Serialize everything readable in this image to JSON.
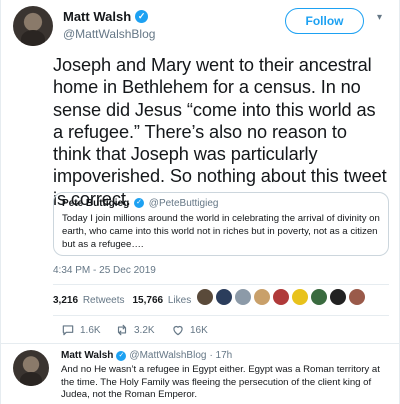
{
  "tweet": {
    "author_name": "Matt Walsh",
    "author_handle": "@MattWalshBlog",
    "follow_label": "Follow",
    "text": "Joseph and Mary went to their ancestral home in Bethlehem for a census. In no sense did Jesus “come into this world as a refugee.” There’s also no reason to think that Joseph was particularly impoverished. So nothing about this tweet is correct.",
    "timestamp": "4:34 PM - 25 Dec 2019"
  },
  "quoted": {
    "name": "Pete Buttigieg",
    "handle": "@PeteButtigieg",
    "text": "Today I join millions around the world in celebrating the arrival of divinity on earth, who came into this world not in riches but in poverty, not as a citizen but as a refugee…."
  },
  "stats": {
    "retweets_count": "3,216",
    "retweets_label": "Retweets",
    "likes_count": "15,766",
    "likes_label": "Likes"
  },
  "actions": {
    "reply_count": "1.6K",
    "retweet_count": "3.2K",
    "like_count": "16K"
  },
  "reply": {
    "author_name": "Matt Walsh",
    "author_handle": "@MattWalshBlog",
    "age": "· 17h",
    "text": "And no He wasn’t a refugee in Egypt either. Egypt was a Roman territory at the time. The Holy Family was fleeing the persecution of the client king of Judea, not the Roman Emperor."
  },
  "colors": {
    "accent": "#1da1f2",
    "text": "#14171a",
    "muted": "#657786",
    "border": "#e6ecf0"
  },
  "icons": {
    "verified": "verified-badge-icon",
    "caret": "chevron-down-icon",
    "reply": "reply-icon",
    "retweet": "retweet-icon",
    "like": "heart-icon"
  }
}
